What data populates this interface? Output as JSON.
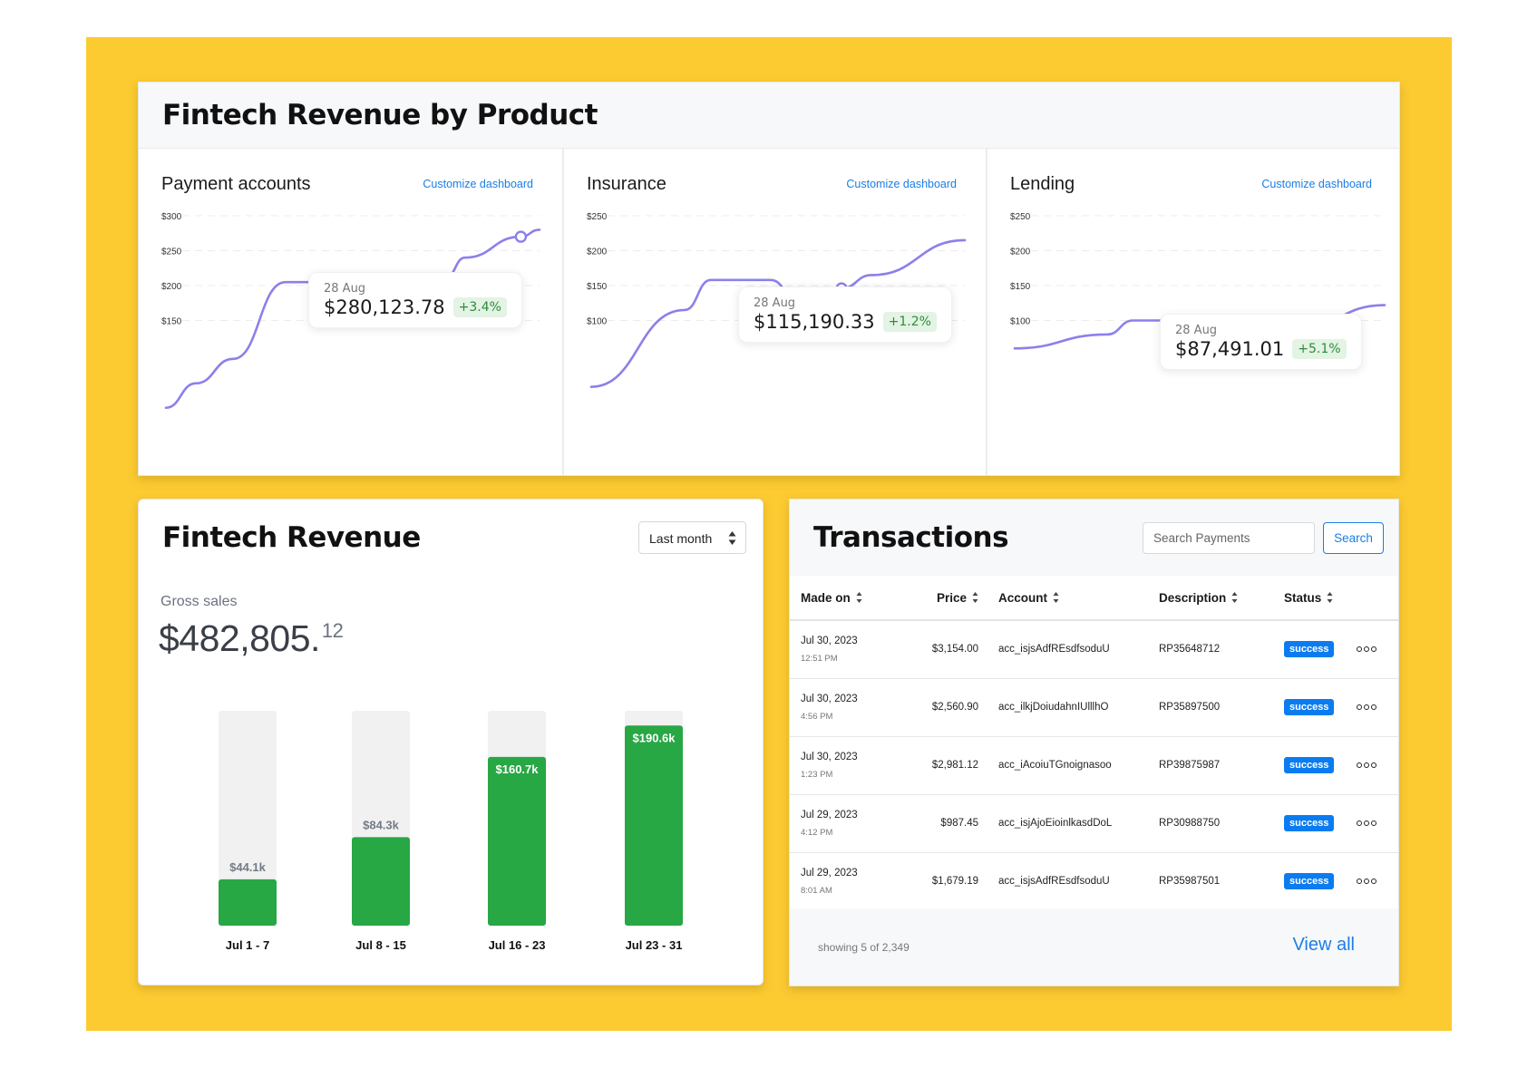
{
  "product_section": {
    "title": "Fintech Revenue by Product",
    "products": [
      {
        "name": "Payment accounts",
        "customize_label": "Customize dashboard",
        "tooltip": {
          "date": "28 Aug",
          "value": "$280,123.78",
          "change": "+3.4%"
        }
      },
      {
        "name": "Insurance",
        "customize_label": "Customize dashboard",
        "tooltip": {
          "date": "28 Aug",
          "value": "$115,190.33",
          "change": "+1.2%"
        }
      },
      {
        "name": "Lending",
        "customize_label": "Customize dashboard",
        "tooltip": {
          "date": "28 Aug",
          "value": "$87,491.01",
          "change": "+5.1%"
        }
      }
    ]
  },
  "chart_data": [
    {
      "type": "area",
      "title": "Payment accounts",
      "y_ticks": [
        "$150",
        "$200",
        "$250",
        "$300"
      ],
      "y_tick_values": [
        150,
        200,
        250,
        300
      ],
      "ylim": [
        0,
        300
      ],
      "x": [
        0,
        0.08,
        0.18,
        0.32,
        0.45,
        0.55,
        0.75,
        0.8,
        0.95,
        1.0
      ],
      "values": [
        25,
        60,
        95,
        205,
        205,
        215,
        212,
        240,
        270,
        280
      ],
      "highlight_index": 8,
      "grid": true
    },
    {
      "type": "area",
      "title": "Insurance",
      "y_ticks": [
        "$100",
        "$150",
        "$200",
        "$250"
      ],
      "y_tick_values": [
        100,
        150,
        200,
        250
      ],
      "ylim": [
        0,
        250
      ],
      "x": [
        0,
        0.25,
        0.32,
        0.48,
        0.55,
        0.67,
        0.75,
        1.0
      ],
      "values": [
        5,
        115,
        158,
        158,
        132,
        146,
        165,
        215
      ],
      "highlight_index": 5,
      "grid": true
    },
    {
      "type": "area",
      "title": "Lending",
      "y_ticks": [
        "$100",
        "$150",
        "$200",
        "$250"
      ],
      "y_tick_values": [
        100,
        150,
        200,
        250
      ],
      "ylim": [
        0,
        250
      ],
      "x": [
        0,
        0.25,
        0.32,
        0.46,
        0.54,
        0.67,
        0.76,
        1.0
      ],
      "values": [
        60,
        80,
        100,
        100,
        78,
        84,
        88,
        122
      ],
      "highlight_index": 5,
      "grid": true
    },
    {
      "type": "bar",
      "title": "Fintech Revenue",
      "categories": [
        "Jul 1 - 7",
        "Jul 8 - 15",
        "Jul 16 - 23",
        "Jul 23 - 31"
      ],
      "values": [
        44.1,
        84.3,
        160.7,
        190.6
      ],
      "labels": [
        "$44.1k",
        "$84.3k",
        "$160.7k",
        "$190.6k"
      ],
      "ylim": [
        0,
        200
      ],
      "unit": "$k"
    }
  ],
  "revenue": {
    "title": "Fintech Revenue",
    "period_select": "Last month",
    "gross_label": "Gross sales",
    "gross_main": "$482,805.",
    "gross_cents": "12",
    "colors": {
      "bar": "#28a745",
      "track": "#f1f1f1"
    }
  },
  "transactions": {
    "title": "Transactions",
    "search_placeholder": "Search Payments",
    "search_button": "Search",
    "columns": [
      "Made on",
      "Price",
      "Account",
      "Description",
      "Status"
    ],
    "rows": [
      {
        "date": "Jul 30, 2023",
        "time": "12:51 PM",
        "price": "$3,154.00",
        "account": "acc_isjsAdfREsdfsoduU",
        "description": "RP35648712",
        "status": "success"
      },
      {
        "date": "Jul 30, 2023",
        "time": "4:56 PM",
        "price": "$2,560.90",
        "account": "acc_ilkjDoiudahnIUlllhO",
        "description": "RP35897500",
        "status": "success"
      },
      {
        "date": "Jul 30, 2023",
        "time": "1:23 PM",
        "price": "$2,981.12",
        "account": "acc_iAcoiuTGnoignasoo",
        "description": "RP39875987",
        "status": "success"
      },
      {
        "date": "Jul 29, 2023",
        "time": "4:12 PM",
        "price": "$987.45",
        "account": "acc_isjAjoEioinlkasdDoL",
        "description": "RP30988750",
        "status": "success"
      },
      {
        "date": "Jul 29, 2023",
        "time": "8:01 AM",
        "price": "$1,679.19",
        "account": "acc_isjsAdfREsdfsoduU",
        "description": "RP35987501",
        "status": "success"
      }
    ],
    "footer_count": "showing 5 of 2,349",
    "view_all": "View all"
  },
  "colors": {
    "background_frame": "#fccb32",
    "line": "#8b80ea",
    "link": "#1a7ee6",
    "status_success": "#0b7cf0",
    "badge_positive_bg": "#e3f3e4",
    "badge_positive_text": "#2e8b3b"
  }
}
